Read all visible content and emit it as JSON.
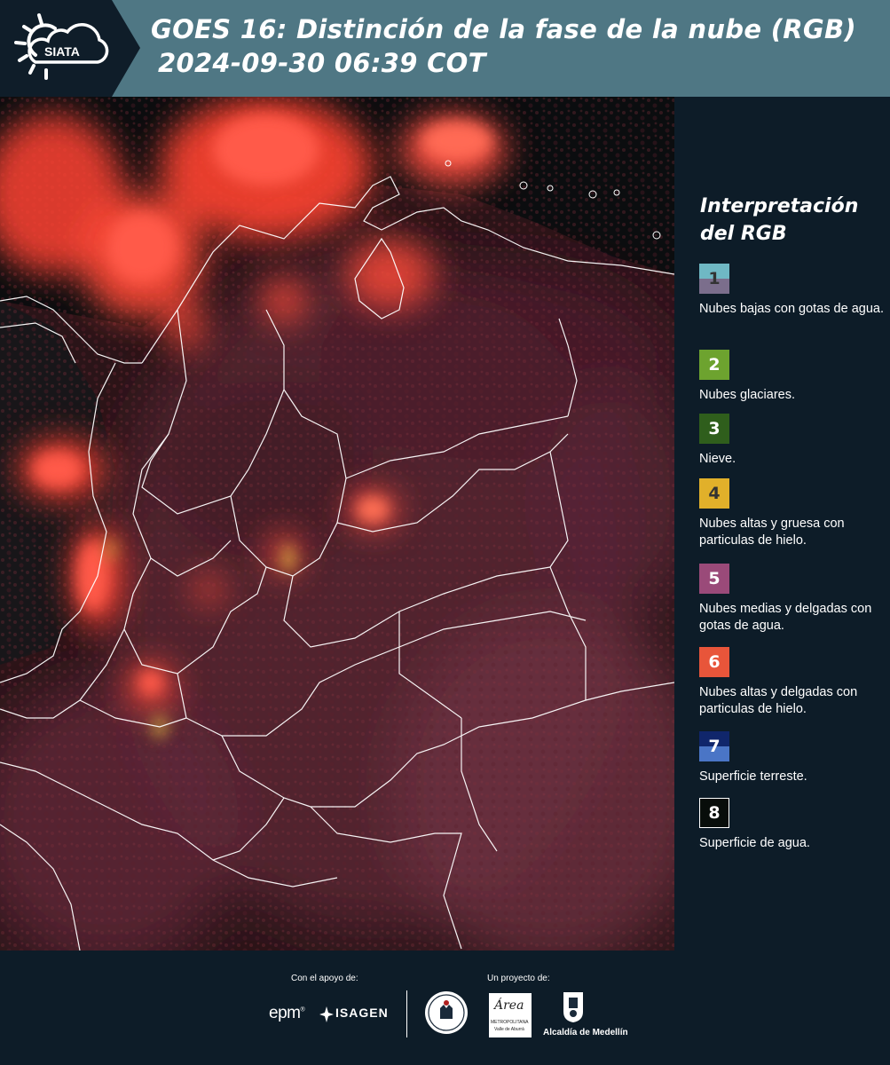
{
  "header": {
    "brand": "SIATA",
    "title_line1": "GOES 16: Distinción de la fase de la nube (RGB)",
    "title_line2": "2024-09-30 06:39 COT"
  },
  "legend": {
    "title_line1": "Interpretación",
    "title_line2": "del RGB",
    "items": [
      {
        "num": "1",
        "label": "Nubes bajas con gotas de agua.",
        "color_top": "#6fb8c4",
        "color_bottom": "#7b6e8c",
        "num_color": "#333333"
      },
      {
        "num": "2",
        "label": "Nubes glaciares.",
        "color_top": "#6da32f",
        "color_bottom": "#6da32f",
        "num_color": "#ffffff"
      },
      {
        "num": "3",
        "label": "Nieve.",
        "color_top": "#2f5e1c",
        "color_bottom": "#2f5e1c",
        "num_color": "#ffffff"
      },
      {
        "num": "4",
        "label": "Nubes altas y gruesa con particulas de hielo.",
        "color_top": "#e1b02a",
        "color_bottom": "#e1b02a",
        "num_color": "#333333"
      },
      {
        "num": "5",
        "label": "Nubes medias y delgadas con gotas de agua.",
        "color_top": "#9a4a79",
        "color_bottom": "#9a4a79",
        "num_color": "#ffffff"
      },
      {
        "num": "6",
        "label": "Nubes altas y delgadas con particulas de hielo.",
        "color_top": "#e8553a",
        "color_bottom": "#e8553a",
        "num_color": "#ffffff"
      },
      {
        "num": "7",
        "label": "Superficie terreste.",
        "color_top": "#10266b",
        "color_bottom": "#4a75c6",
        "num_color": "#ffffff"
      },
      {
        "num": "8",
        "label": "Superficie de agua.",
        "color_top": "#080d0a",
        "color_bottom": "#080d0a",
        "num_color": "#ffffff"
      }
    ]
  },
  "footer": {
    "support_label": "Con el apoyo de:",
    "project_label": "Un proyecto de:",
    "epm": "epm",
    "isagen": "ISAGEN",
    "metro": "Área",
    "metro_sub1": "METROPOLITANA",
    "metro_sub2": "Valle de Aburrá",
    "alcaldia": "Alcaldía de Medellín"
  },
  "colors": {
    "header_bg": "#4f7784",
    "panel_bg": "#0d1c28",
    "cloud_red": "#ff4a3a"
  },
  "icons": {
    "sun": "sun-cloud-icon",
    "isagen_mark": "isagen-star-icon"
  }
}
